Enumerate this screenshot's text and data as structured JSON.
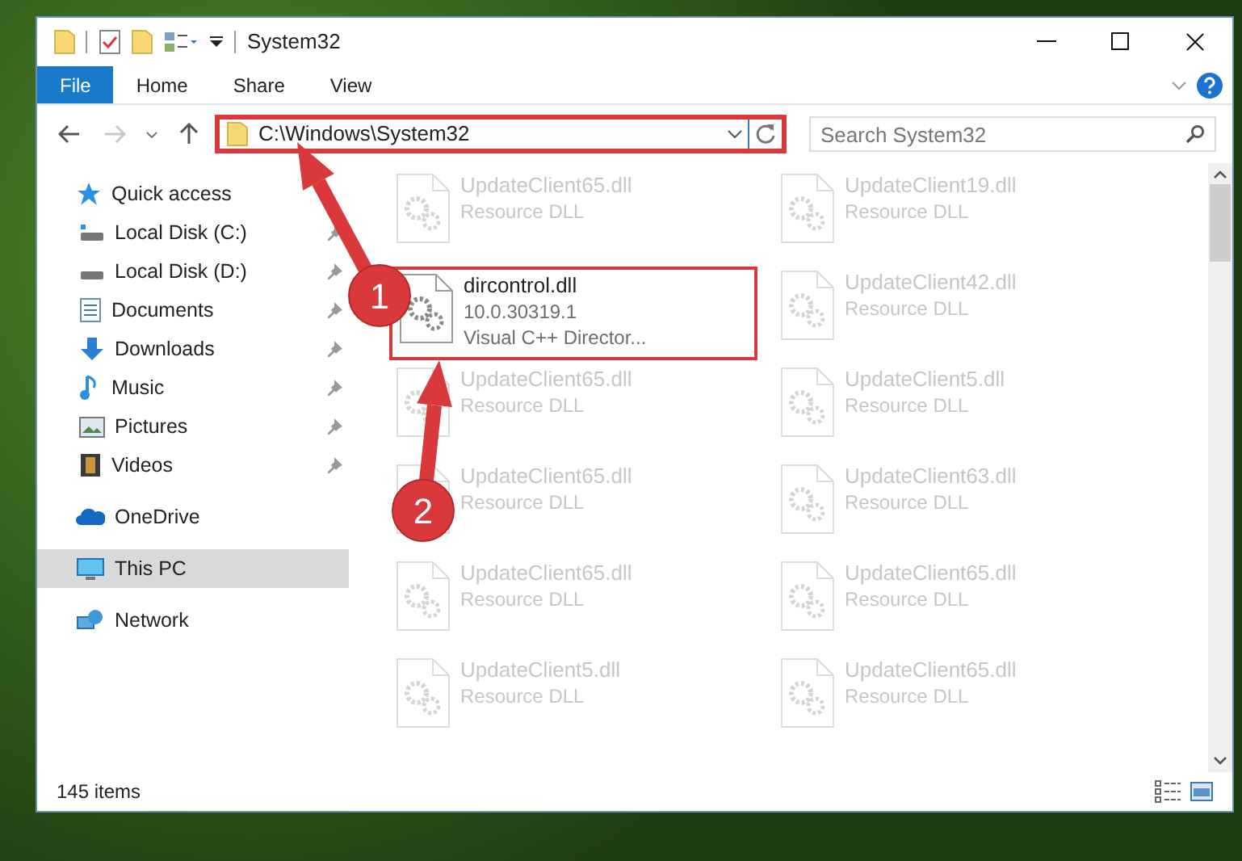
{
  "window": {
    "title": "System32"
  },
  "ribbon": {
    "tabs": [
      {
        "label": "File",
        "selected": true
      },
      {
        "label": "Home",
        "selected": false
      },
      {
        "label": "Share",
        "selected": false
      },
      {
        "label": "View",
        "selected": false
      }
    ]
  },
  "address_bar": {
    "path": "C:\\Windows\\System32",
    "highlighted": true
  },
  "search": {
    "placeholder": "Search System32"
  },
  "navigation_pane": {
    "items": [
      {
        "label": "Quick access",
        "selected": false,
        "children": [
          {
            "label": "Local Disk (C:)",
            "pinned": true,
            "selected": false
          },
          {
            "label": "Local Disk (D:)",
            "pinned": true,
            "selected": false
          },
          {
            "label": "Documents",
            "pinned": true,
            "selected": false
          },
          {
            "label": "Downloads",
            "pinned": true,
            "selected": false
          },
          {
            "label": "Music",
            "pinned": true,
            "selected": false
          },
          {
            "label": "Pictures",
            "pinned": true,
            "selected": false
          },
          {
            "label": "Videos",
            "pinned": true,
            "selected": false
          }
        ]
      },
      {
        "label": "OneDrive",
        "selected": false
      },
      {
        "label": "This PC",
        "selected": true
      },
      {
        "label": "Network",
        "selected": false
      }
    ]
  },
  "files": [
    {
      "name": "UpdateClient65.dll",
      "details": [
        "Resource DLL"
      ],
      "faded": true,
      "highlighted": false
    },
    {
      "name": "UpdateClient19.dll",
      "details": [
        "Resource DLL"
      ],
      "faded": true,
      "highlighted": false
    },
    {
      "name": "dircontrol.dll",
      "details": [
        "10.0.30319.1",
        "Visual C++ Director..."
      ],
      "faded": false,
      "highlighted": true
    },
    {
      "name": "UpdateClient42.dll",
      "details": [
        "Resource DLL"
      ],
      "faded": true,
      "highlighted": false
    },
    {
      "name": "UpdateClient65.dll",
      "details": [
        "Resource DLL"
      ],
      "faded": true,
      "highlighted": false
    },
    {
      "name": "UpdateClient5.dll",
      "details": [
        "Resource DLL"
      ],
      "faded": true,
      "highlighted": false
    },
    {
      "name": "UpdateClient65.dll",
      "details": [
        "Resource DLL"
      ],
      "faded": true,
      "highlighted": false
    },
    {
      "name": "UpdateClient63.dll",
      "details": [
        "Resource DLL"
      ],
      "faded": true,
      "highlighted": false
    },
    {
      "name": "UpdateClient65.dll",
      "details": [
        "Resource DLL"
      ],
      "faded": true,
      "highlighted": false
    },
    {
      "name": "UpdateClient65.dll",
      "details": [
        "Resource DLL"
      ],
      "faded": true,
      "highlighted": false
    },
    {
      "name": "UpdateClient5.dll",
      "details": [
        "Resource DLL"
      ],
      "faded": true,
      "highlighted": false
    },
    {
      "name": "UpdateClient65.dll",
      "details": [
        "Resource DLL"
      ],
      "faded": true,
      "highlighted": false
    }
  ],
  "status_bar": {
    "item_count": "145 items"
  },
  "annotations": [
    {
      "number": "1"
    },
    {
      "number": "2"
    }
  ]
}
